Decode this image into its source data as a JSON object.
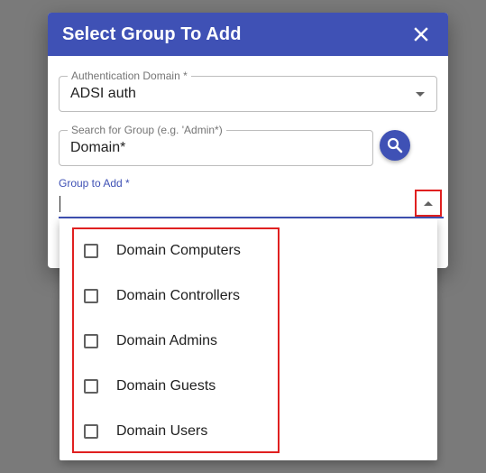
{
  "dialog": {
    "title": "Select Group To Add",
    "close_icon": "close-icon"
  },
  "auth_domain": {
    "label": "Authentication Domain *",
    "value": "ADSI auth"
  },
  "search": {
    "label": "Search for Group (e.g. 'Admin*)",
    "value": "Domain*",
    "button_icon": "search-icon"
  },
  "group_to_add": {
    "label": "Group to Add *",
    "value": ""
  },
  "options": [
    {
      "label": "Domain Computers",
      "checked": false
    },
    {
      "label": "Domain Controllers",
      "checked": false
    },
    {
      "label": "Domain Admins",
      "checked": false
    },
    {
      "label": "Domain Guests",
      "checked": false
    },
    {
      "label": "Domain Users",
      "checked": false
    }
  ],
  "colors": {
    "primary": "#3f51b5",
    "highlight": "#e02020",
    "backdrop": "#7a7a7a"
  }
}
